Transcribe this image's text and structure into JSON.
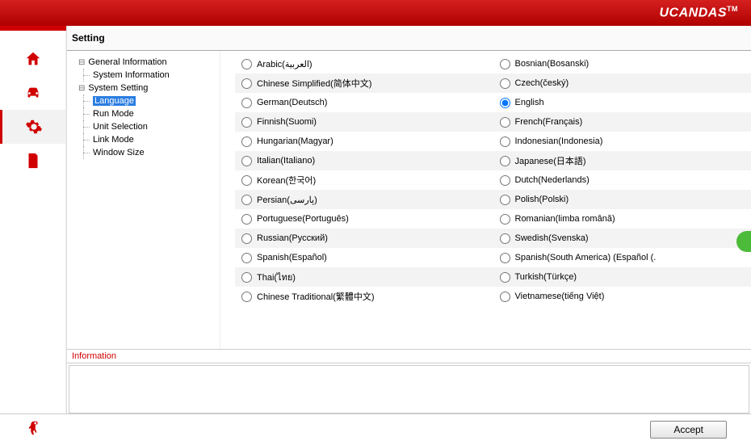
{
  "brand": "UCANDAS",
  "brand_tm": "TM",
  "page_title": "Setting",
  "tree": {
    "groups": [
      {
        "label": "General Information",
        "items": [
          {
            "label": "System Information",
            "selected": false
          }
        ]
      },
      {
        "label": "System Setting",
        "items": [
          {
            "label": "Language",
            "selected": true
          },
          {
            "label": "Run Mode",
            "selected": false
          },
          {
            "label": "Unit Selection",
            "selected": false
          },
          {
            "label": "Link Mode",
            "selected": false
          },
          {
            "label": "Window Size",
            "selected": false
          }
        ]
      }
    ]
  },
  "language_columns": [
    [
      {
        "label": "Arabic(العربية)",
        "checked": false
      },
      {
        "label": "Chinese Simplified(简体中文)",
        "checked": false
      },
      {
        "label": "German(Deutsch)",
        "checked": false
      },
      {
        "label": "Finnish(Suomi)",
        "checked": false
      },
      {
        "label": "Hungarian(Magyar)",
        "checked": false
      },
      {
        "label": "Italian(Italiano)",
        "checked": false
      },
      {
        "label": "Korean(한국어)",
        "checked": false
      },
      {
        "label": "Persian(پارسی)",
        "checked": false
      },
      {
        "label": "Portuguese(Português)",
        "checked": false
      },
      {
        "label": "Russian(Русский)",
        "checked": false
      },
      {
        "label": "Spanish(Español)",
        "checked": false
      },
      {
        "label": "Thai(ไทย)",
        "checked": false
      },
      {
        "label": "Chinese Traditional(繁體中文)",
        "checked": false
      }
    ],
    [
      {
        "label": "Bosnian(Bosanski)",
        "checked": false
      },
      {
        "label": "Czech(český)",
        "checked": false
      },
      {
        "label": "English",
        "checked": true
      },
      {
        "label": "French(Français)",
        "checked": false
      },
      {
        "label": "Indonesian(Indonesia)",
        "checked": false
      },
      {
        "label": "Japanese(日本語)",
        "checked": false
      },
      {
        "label": "Dutch(Nederlands)",
        "checked": false
      },
      {
        "label": "Polish(Polski)",
        "checked": false
      },
      {
        "label": "Romanian(limba română)",
        "checked": false
      },
      {
        "label": "Swedish(Svenska)",
        "checked": false
      },
      {
        "label": "Spanish(South America) (Español (.",
        "checked": false
      },
      {
        "label": "Turkish(Türkçe)",
        "checked": false
      },
      {
        "label": "Vietnamese(tiếng Việt)",
        "checked": false
      }
    ]
  ],
  "info_label": "Information",
  "accept_label": "Accept"
}
